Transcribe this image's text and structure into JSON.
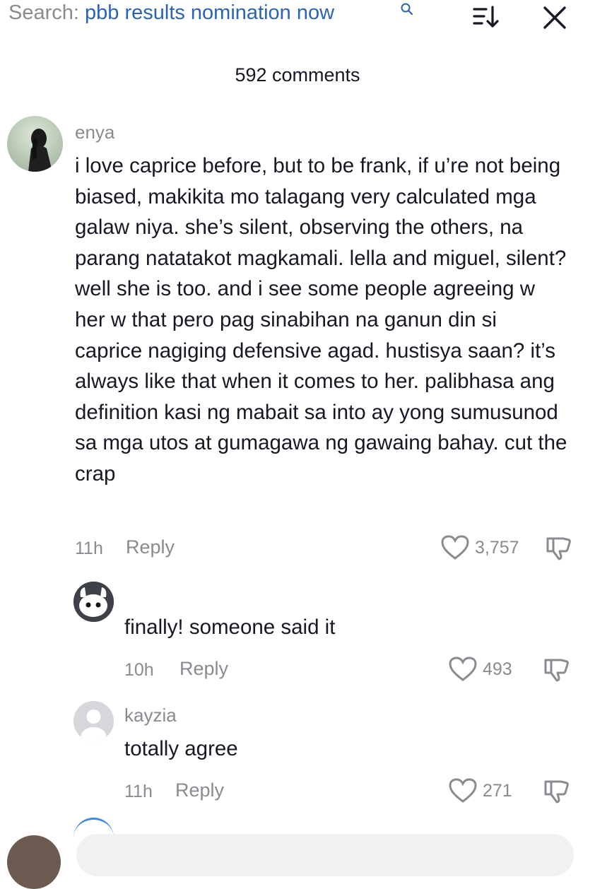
{
  "header": {
    "search_prefix": "Search:",
    "search_query": "pbb results nomination now",
    "comment_count": "592 comments",
    "icons": [
      "search-icon",
      "sort-icon",
      "close-icon"
    ]
  },
  "comments": [
    {
      "username": "enya",
      "text": "i love caprice before, but to be frank, if u’re not being biased, makikita mo talagang very calculated mga galaw niya. she’s silent, observing the others, na parang natatakot magkamali. lella and miguel, silent? well she is too. and i see some people agreeing w her w that pero pag sinabihan na ganun din si caprice nagiging defensive agad. hustisya saan? it’s always like that when it comes to her. palibhasa ang definition kasi ng mabait sa into ay yong sumusunod sa mga utos at gumagawa ng gawaing bahay. cut the crap",
      "time": "11h",
      "reply_label": "Reply",
      "likes": "3,757"
    },
    {
      "username": "",
      "text": "finally! someone said it",
      "time": "10h",
      "reply_label": "Reply",
      "likes": "493"
    },
    {
      "username": "kayzia",
      "text": "totally agree",
      "time": "11h",
      "reply_label": "Reply",
      "likes": "271"
    }
  ],
  "colors": {
    "query": "#2b64b5",
    "muted": "#8a8b91",
    "text": "#161823"
  }
}
